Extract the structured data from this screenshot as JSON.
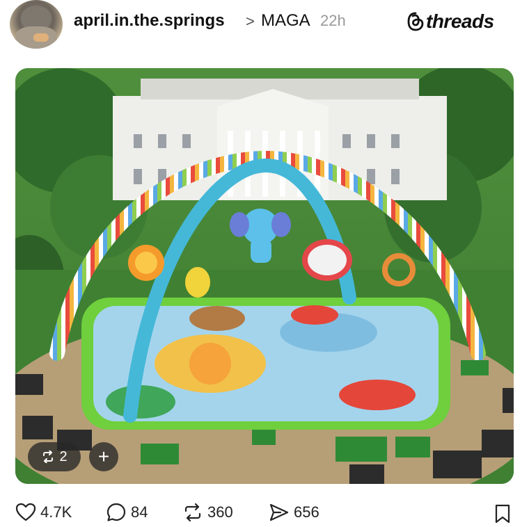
{
  "post": {
    "username": "april.in.the.springs",
    "crumb_separator": ">",
    "topic": "MAGA",
    "time_ago": "22h"
  },
  "brand": {
    "name": "threads"
  },
  "media": {
    "reposts_badge": "2",
    "add_label": "+"
  },
  "actions": {
    "likes": "4.7K",
    "replies": "84",
    "reposts": "360",
    "shares": "656"
  },
  "icons": {
    "like": "heart-icon",
    "reply": "speech-bubble-icon",
    "repost": "repost-arrows-icon",
    "share": "paper-plane-icon",
    "bookmark": "bookmark-icon",
    "brand": "threads-logo-icon"
  },
  "colors": {
    "text": "#111111",
    "muted": "#999999",
    "overlay": "#282828"
  }
}
